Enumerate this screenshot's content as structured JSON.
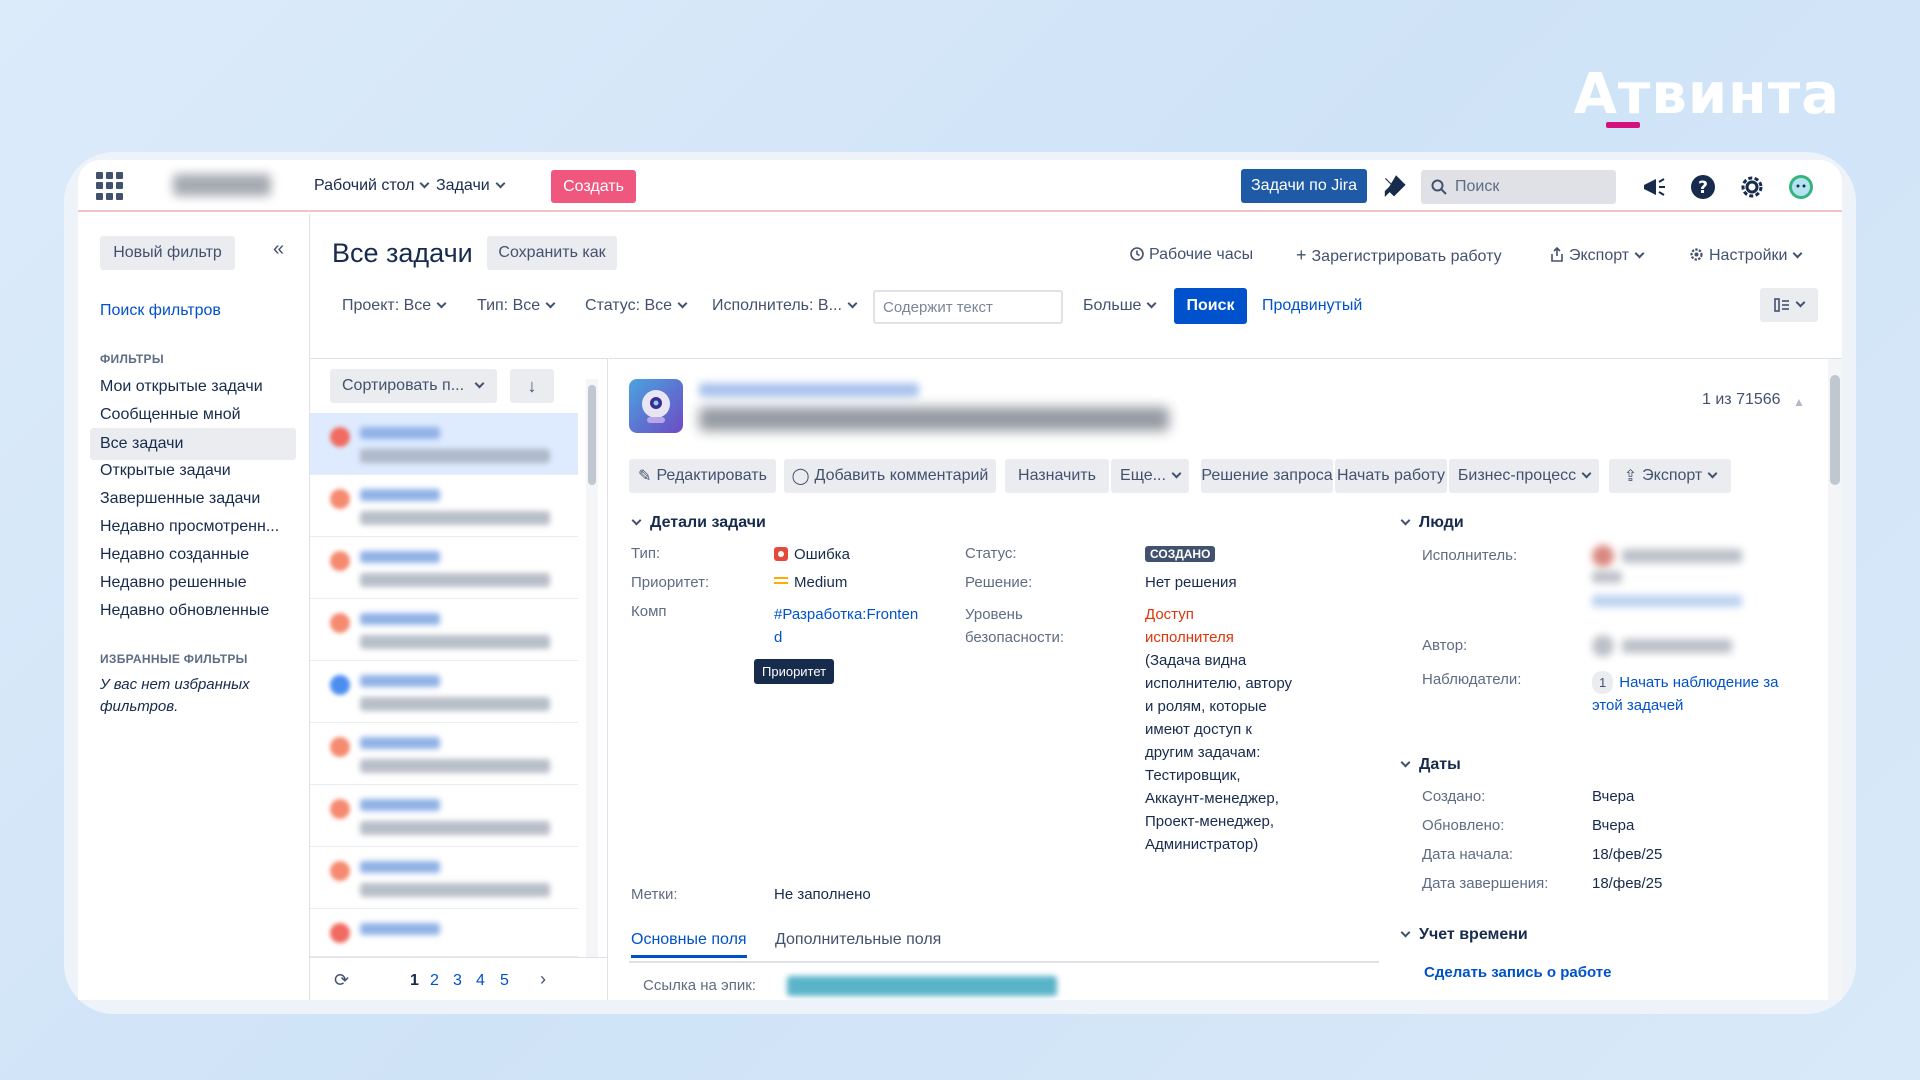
{
  "brand": "Атвинта",
  "topnav": {
    "items": [
      "Рабочий стол",
      "Задачи"
    ],
    "create_label": "Создать",
    "jira_label": "Задачи по Jira",
    "search_placeholder": "Поиск"
  },
  "sidebar": {
    "new_filter": "Новый фильтр",
    "collapse": "«",
    "search_filters": "Поиск фильтров",
    "filters_heading": "ФИЛЬТРЫ",
    "filters": [
      "Мои открытые задачи",
      "Сообщенные мной",
      "Все задачи",
      "Открытые задачи",
      "Завершенные задачи",
      "Недавно просмотренн...",
      "Недавно созданные",
      "Недавно решенные",
      "Недавно обновленные"
    ],
    "active_filter_index": 2,
    "favorites_heading": "ИЗБРАННЫЕ ФИЛЬТРЫ",
    "favorites_empty": "У вас нет избранных фильтров."
  },
  "header": {
    "title": "Все задачи",
    "save_as": "Сохранить как",
    "actions": [
      "Рабочие часы",
      "Зарегистрировать работу",
      "Экспорт",
      "Настройки"
    ]
  },
  "filters_bar": {
    "project": "Проект: Все",
    "type": "Тип: Все",
    "status": "Статус: Все",
    "assignee": "Исполнитель: В...",
    "text_placeholder": "Содержит текст",
    "more": "Больше",
    "search": "Поиск",
    "advanced": "Продвинутый"
  },
  "list": {
    "sort_label": "Сортировать п...",
    "sort_dir": "↓",
    "rows": 9,
    "pages": [
      "1",
      "2",
      "3",
      "4",
      "5"
    ],
    "current_page": "1",
    "next": "›"
  },
  "detail": {
    "counter": "1 из 71566",
    "actions": [
      "Редактировать",
      "Добавить комментарий",
      "Назначить",
      "Еще...",
      "Решение запроса",
      "Начать работу",
      "Бизнес-процесс",
      "Экспорт"
    ],
    "details_heading": "Детали задачи",
    "type_label": "Тип:",
    "type_value": "Ошибка",
    "priority_label": "Приоритет:",
    "priority_value": "Medium",
    "component_label_partial": "Комп",
    "component_value": "#Разработка:Frontend",
    "tooltip": "Приоритет",
    "status_label": "Статус:",
    "status_value": "СОЗДАНО",
    "resolution_label": "Решение:",
    "resolution_value": "Нет решения",
    "security_label": "Уровень безопасности:",
    "security_value_red": "Доступ исполнителя",
    "security_value_desc": "(Задача видна исполнителю, автору и ролям, которые имеют доступ к другим задачам: Тестировщик, Аккаунт-менеджер, Проект-менеджер, Администратор)",
    "labels_label": "Метки:",
    "labels_value": "Не заполнено",
    "tabs": [
      "Основные поля",
      "Дополнительные поля"
    ],
    "epic_label": "Ссылка на эпик:",
    "people_heading": "Люди",
    "assignee_label": "Исполнитель:",
    "author_label": "Автор:",
    "watchers_label": "Наблюдатели:",
    "watchers_count": "1",
    "watch_link": "Начать наблюдение за этой задачей",
    "dates_heading": "Даты",
    "created_label": "Создано:",
    "created_value": "Вчера",
    "updated_label": "Обновлено:",
    "updated_value": "Вчера",
    "start_label": "Дата начала:",
    "start_value": "18/фев/25",
    "end_label": "Дата завершения:",
    "end_value": "18/фев/25",
    "time_heading": "Учет времени",
    "log_work": "Сделать запись о работе"
  },
  "colors": {
    "create": "#f0577f",
    "jira": "#1f5aa6",
    "primary": "#0052cc",
    "brand_accent": "#d6117c"
  }
}
